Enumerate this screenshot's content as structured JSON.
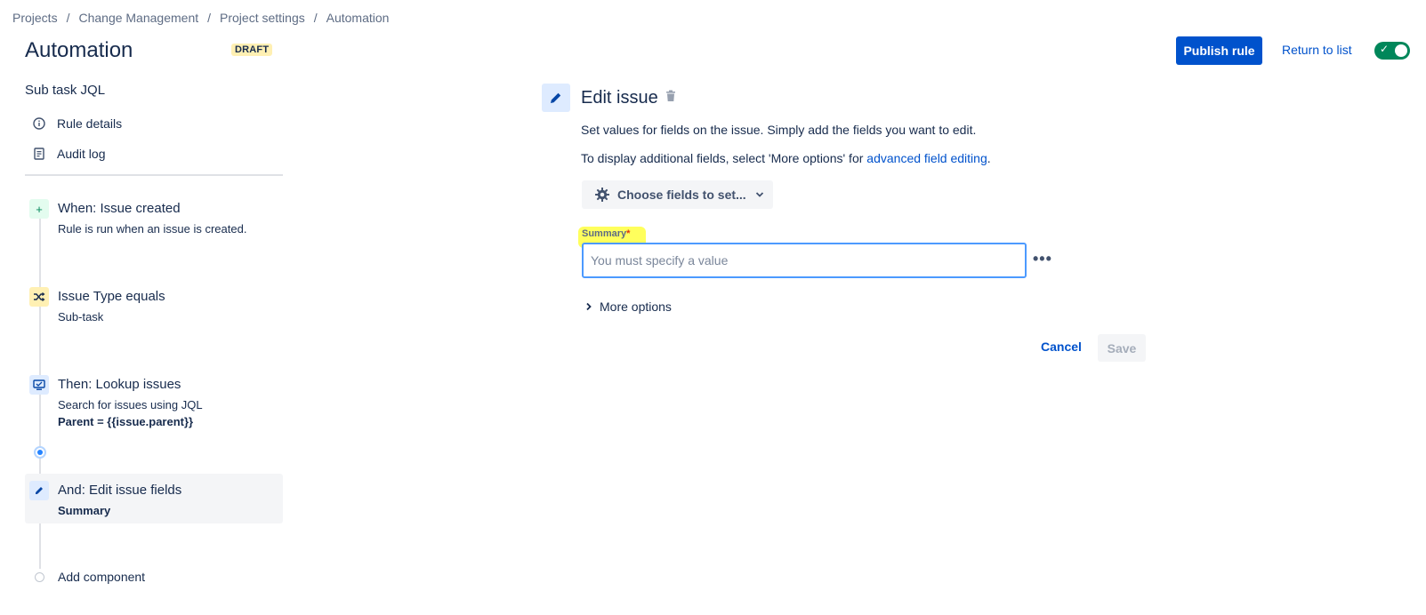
{
  "breadcrumb": [
    "Projects",
    "Change Management",
    "Project settings",
    "Automation"
  ],
  "header": {
    "title": "Automation",
    "badge": "DRAFT",
    "publish_label": "Publish rule",
    "return_label": "Return to list",
    "toggle_on": true
  },
  "sidebar": {
    "rule_name": "Sub task JQL",
    "nav": [
      {
        "label": "Rule details",
        "icon": "info-icon"
      },
      {
        "label": "Audit log",
        "icon": "document-icon"
      }
    ],
    "steps": [
      {
        "title": "When: Issue created",
        "sub": "Rule is run when an issue is created.",
        "sub2": "",
        "icon": "plus-icon",
        "color": "#e3fcef"
      },
      {
        "title": "Issue Type equals",
        "sub": "Sub-task",
        "sub2": "",
        "icon": "shuffle-icon",
        "color": "#fff0b3"
      },
      {
        "title": "Then: Lookup issues",
        "sub": "Search for issues using JQL",
        "sub2": "Parent = {{issue.parent}}",
        "icon": "monitor-icon",
        "color": "#deebff"
      },
      {
        "title": "And: Edit issue fields",
        "sub": "",
        "sub2": "Summary",
        "icon": "pencil-icon",
        "color": "#deebff",
        "selected": true
      }
    ],
    "add_component": "Add component"
  },
  "editor": {
    "title": "Edit issue",
    "desc1": "Set values for fields on the issue. Simply add the fields you want to edit.",
    "desc2_prefix": "To display additional fields, select 'More options' for ",
    "desc2_link": "advanced field editing",
    "desc2_suffix": ".",
    "choose_label": "Choose fields to set...",
    "summary_label": "Summary",
    "required_mark": "*",
    "summary_placeholder": "You must specify a value",
    "summary_value": "",
    "more_options": "More options",
    "cancel_label": "Cancel",
    "save_label": "Save"
  },
  "colors": {
    "accent": "#0052cc",
    "toggle": "#00875a",
    "highlight": "#ffff5c"
  }
}
